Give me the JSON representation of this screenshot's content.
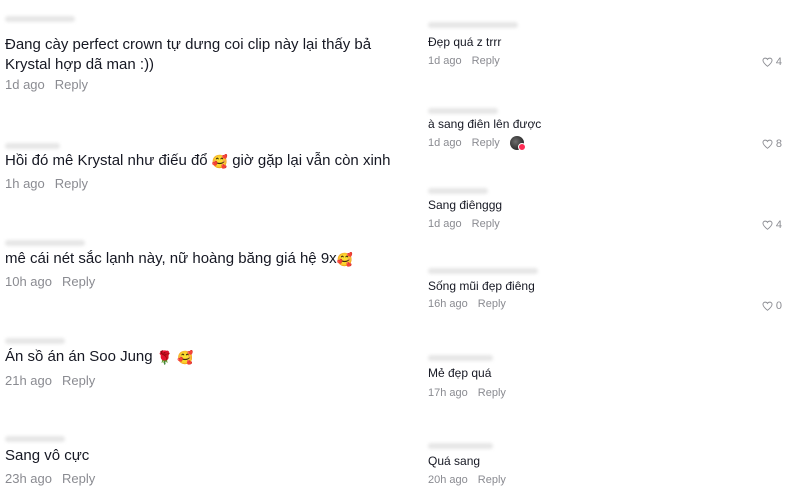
{
  "left_comments": [
    {
      "text": "Đang cày perfect crown tự dưng coi clip này lại thấy bả",
      "text2": "Krystal hợp dã man :))",
      "time": "1d ago",
      "reply": "Reply"
    },
    {
      "text": "Hồi đó mê Krystal như điếu đổ",
      "emoji": "🥰",
      "text_after": " giờ gặp lại vẫn còn xinh",
      "time": "1h ago",
      "reply": "Reply"
    },
    {
      "text": "mê cái nét sắc lạnh này, nữ hoàng băng giá hệ 9x",
      "emoji": "🥰",
      "time": "10h ago",
      "reply": "Reply"
    },
    {
      "text": "Án sồ án án Soo Jung",
      "emoji": "🌹",
      "emoji2": "🥰",
      "time": "21h ago",
      "reply": "Reply"
    },
    {
      "text": "Sang vô cực",
      "time": "23h ago",
      "reply": "Reply"
    }
  ],
  "right_comments": [
    {
      "text": "Đẹp quá z trrr",
      "time": "1d ago",
      "reply": "Reply",
      "likes": "4"
    },
    {
      "text": "à sang điên lên được",
      "time": "1d ago",
      "reply": "Reply",
      "likes": "8",
      "avatar": "creator-avatar"
    },
    {
      "text": "Sang điênggg",
      "time": "1d ago",
      "reply": "Reply",
      "likes": "4"
    },
    {
      "text": "Sống mũi đẹp điêng",
      "time": "16h ago",
      "reply": "Reply",
      "likes": "0"
    },
    {
      "text": "Mẻ đẹp quá",
      "time": "17h ago",
      "reply": "Reply"
    },
    {
      "text": "Quá sang",
      "time": "20h ago",
      "reply": "Reply"
    }
  ],
  "colors": {
    "text": "#161823",
    "muted": "#8a8b91",
    "accent": "#fe2c55"
  },
  "icons": {
    "like": "heart-outline-icon",
    "creator": "creator-avatar"
  }
}
